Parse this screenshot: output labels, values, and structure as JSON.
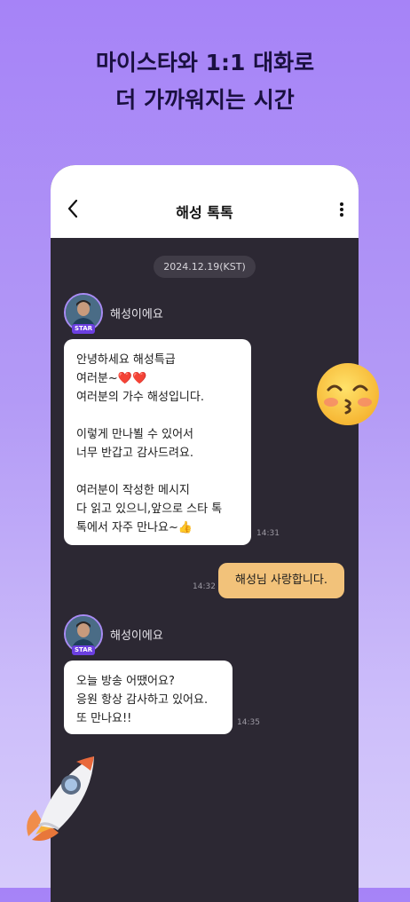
{
  "headline": {
    "line1": "마이스타와 1:1 대화로",
    "line2": "더 가까워지는 시간"
  },
  "chat": {
    "title": "해성 톡톡",
    "date": "2024.12.19(KST)",
    "star_badge": "STAR",
    "messages": [
      {
        "sender": "해성이에요",
        "lines": [
          "안녕하세요 해성특급",
          "여러분~❤️❤️",
          "여러분의 가수 해성입니다.",
          "",
          "이렇게 만나뵐 수 있어서",
          "너무 반갑고 감사드려요.",
          "",
          "여러분이 작성한 메시지",
          "다 읽고 있으니,앞으로 스타 톡",
          "톡에서 자주 만나요~👍"
        ],
        "time": "14:31"
      },
      {
        "text": "해성님 사랑합니다.",
        "time": "14:32"
      },
      {
        "sender": "해성이에요",
        "lines": [
          "오늘 방송 어땠어요?",
          "응원 항상 감사하고 있어요.",
          "또 만나요!!"
        ],
        "time": "14:35"
      }
    ]
  },
  "colors": {
    "background_top": "#a683f7",
    "chat_bg": "#2c2833",
    "user_bubble": "#f2c27a",
    "accent": "#6b3fe0"
  },
  "icons": [
    "back-arrow-icon",
    "more-vertical-icon",
    "kissing-face-icon",
    "rocket-icon"
  ]
}
